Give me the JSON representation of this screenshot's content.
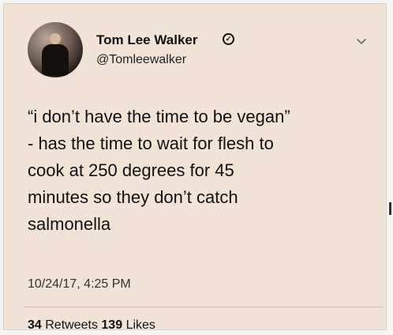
{
  "user": {
    "name": "Tom Lee Walker",
    "handle": "@Tomleewalker"
  },
  "tweet": {
    "text": "“i don’t have the time to be vegan”\n- has the time to wait for flesh to\ncook at 250 degrees for 45\nminutes so they don’t catch\nsalmonella",
    "timestamp": "10/24/17, 4:25 PM"
  },
  "stats": {
    "retweets_count": "34",
    "retweets_label": "Retweets",
    "likes_count": "139",
    "likes_label": "Likes"
  },
  "colors": {
    "card_background": "#f1e3d6",
    "text": "#111111"
  },
  "icons": {
    "verified": "verified-badge-icon",
    "menu": "chevron-down-icon"
  }
}
